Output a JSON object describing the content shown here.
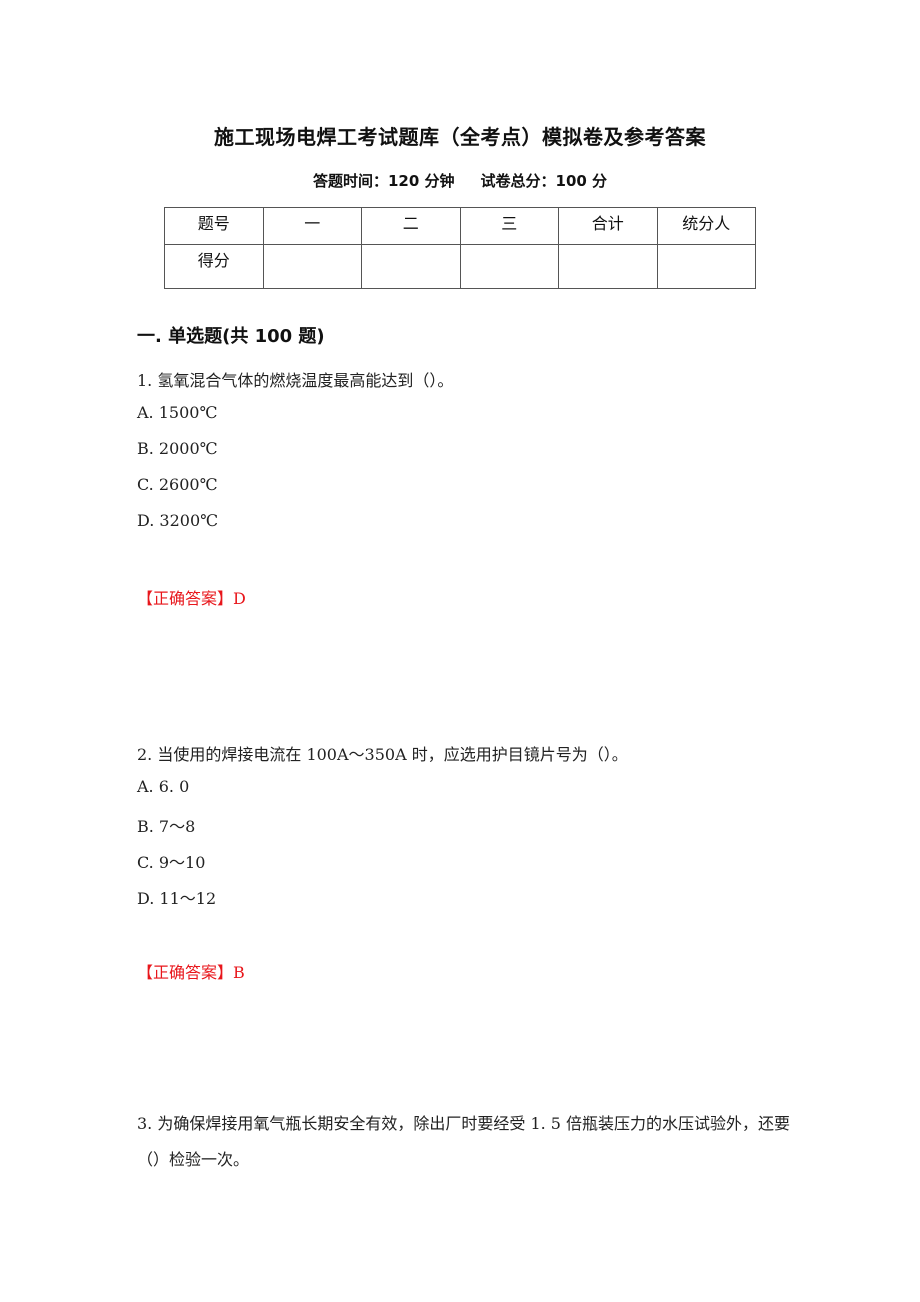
{
  "document": {
    "title": "施工现场电焊工考试题库（全考点）模拟卷及参考答案",
    "exam_time_label": "答题时间：120 分钟",
    "total_score_label": "试卷总分：100 分"
  },
  "score_table": {
    "header": [
      "题号",
      "一",
      "二",
      "三",
      "合计",
      "统分人"
    ],
    "row": [
      "得分",
      "",
      "",
      "",
      "",
      ""
    ]
  },
  "section": {
    "title": "一. 单选题(共 100 题)"
  },
  "questions": [
    {
      "text": "1. 氢氧混合气体的燃烧温度最高能达到（）。",
      "options": [
        "A. 1500℃",
        "B. 2000℃",
        "C. 2600℃",
        "D. 3200℃"
      ],
      "answer_label": "【正确答案】D"
    },
    {
      "text": "2. 当使用的焊接电流在 100A～350A 时，应选用护目镜片号为（）。",
      "options": [
        "A. 6. 0",
        "B. 7～8",
        "C. 9～10",
        "D. 11～12"
      ],
      "answer_label": "【正确答案】B"
    },
    {
      "text": "3. 为确保焊接用氧气瓶长期安全有效，除出厂时要经受 1. 5 倍瓶装压力的水压试验外，还要（）检验一次。"
    }
  ],
  "colors": {
    "answer": "#e8161b",
    "text": "#222222",
    "table_border": "#555555"
  }
}
